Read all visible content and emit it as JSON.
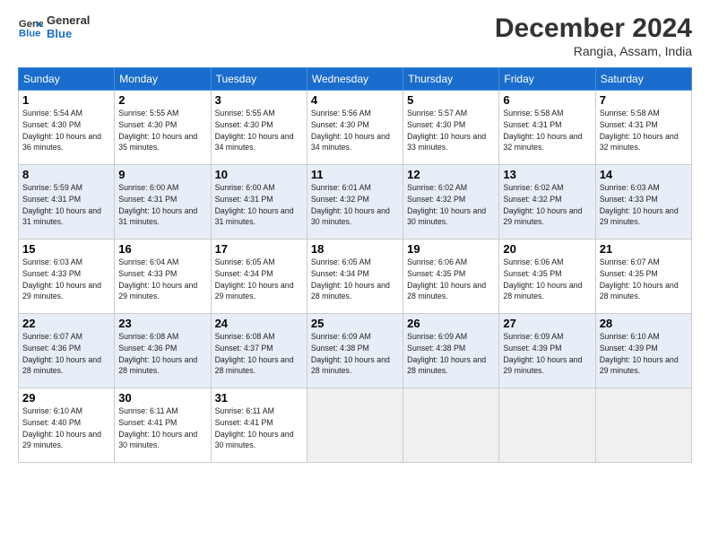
{
  "logo": {
    "line1": "General",
    "line2": "Blue"
  },
  "title": "December 2024",
  "location": "Rangia, Assam, India",
  "weekdays": [
    "Sunday",
    "Monday",
    "Tuesday",
    "Wednesday",
    "Thursday",
    "Friday",
    "Saturday"
  ],
  "weeks": [
    [
      {
        "day": "1",
        "rise": "5:54 AM",
        "set": "4:30 PM",
        "hours": "10 hours and 36 minutes."
      },
      {
        "day": "2",
        "rise": "5:55 AM",
        "set": "4:30 PM",
        "hours": "10 hours and 35 minutes."
      },
      {
        "day": "3",
        "rise": "5:55 AM",
        "set": "4:30 PM",
        "hours": "10 hours and 34 minutes."
      },
      {
        "day": "4",
        "rise": "5:56 AM",
        "set": "4:30 PM",
        "hours": "10 hours and 34 minutes."
      },
      {
        "day": "5",
        "rise": "5:57 AM",
        "set": "4:30 PM",
        "hours": "10 hours and 33 minutes."
      },
      {
        "day": "6",
        "rise": "5:58 AM",
        "set": "4:31 PM",
        "hours": "10 hours and 32 minutes."
      },
      {
        "day": "7",
        "rise": "5:58 AM",
        "set": "4:31 PM",
        "hours": "10 hours and 32 minutes."
      }
    ],
    [
      {
        "day": "8",
        "rise": "5:59 AM",
        "set": "4:31 PM",
        "hours": "10 hours and 31 minutes."
      },
      {
        "day": "9",
        "rise": "6:00 AM",
        "set": "4:31 PM",
        "hours": "10 hours and 31 minutes."
      },
      {
        "day": "10",
        "rise": "6:00 AM",
        "set": "4:31 PM",
        "hours": "10 hours and 31 minutes."
      },
      {
        "day": "11",
        "rise": "6:01 AM",
        "set": "4:32 PM",
        "hours": "10 hours and 30 minutes."
      },
      {
        "day": "12",
        "rise": "6:02 AM",
        "set": "4:32 PM",
        "hours": "10 hours and 30 minutes."
      },
      {
        "day": "13",
        "rise": "6:02 AM",
        "set": "4:32 PM",
        "hours": "10 hours and 29 minutes."
      },
      {
        "day": "14",
        "rise": "6:03 AM",
        "set": "4:33 PM",
        "hours": "10 hours and 29 minutes."
      }
    ],
    [
      {
        "day": "15",
        "rise": "6:03 AM",
        "set": "4:33 PM",
        "hours": "10 hours and 29 minutes."
      },
      {
        "day": "16",
        "rise": "6:04 AM",
        "set": "4:33 PM",
        "hours": "10 hours and 29 minutes."
      },
      {
        "day": "17",
        "rise": "6:05 AM",
        "set": "4:34 PM",
        "hours": "10 hours and 29 minutes."
      },
      {
        "day": "18",
        "rise": "6:05 AM",
        "set": "4:34 PM",
        "hours": "10 hours and 28 minutes."
      },
      {
        "day": "19",
        "rise": "6:06 AM",
        "set": "4:35 PM",
        "hours": "10 hours and 28 minutes."
      },
      {
        "day": "20",
        "rise": "6:06 AM",
        "set": "4:35 PM",
        "hours": "10 hours and 28 minutes."
      },
      {
        "day": "21",
        "rise": "6:07 AM",
        "set": "4:35 PM",
        "hours": "10 hours and 28 minutes."
      }
    ],
    [
      {
        "day": "22",
        "rise": "6:07 AM",
        "set": "4:36 PM",
        "hours": "10 hours and 28 minutes."
      },
      {
        "day": "23",
        "rise": "6:08 AM",
        "set": "4:36 PM",
        "hours": "10 hours and 28 minutes."
      },
      {
        "day": "24",
        "rise": "6:08 AM",
        "set": "4:37 PM",
        "hours": "10 hours and 28 minutes."
      },
      {
        "day": "25",
        "rise": "6:09 AM",
        "set": "4:38 PM",
        "hours": "10 hours and 28 minutes."
      },
      {
        "day": "26",
        "rise": "6:09 AM",
        "set": "4:38 PM",
        "hours": "10 hours and 28 minutes."
      },
      {
        "day": "27",
        "rise": "6:09 AM",
        "set": "4:39 PM",
        "hours": "10 hours and 29 minutes."
      },
      {
        "day": "28",
        "rise": "6:10 AM",
        "set": "4:39 PM",
        "hours": "10 hours and 29 minutes."
      }
    ],
    [
      {
        "day": "29",
        "rise": "6:10 AM",
        "set": "4:40 PM",
        "hours": "10 hours and 29 minutes."
      },
      {
        "day": "30",
        "rise": "6:11 AM",
        "set": "4:41 PM",
        "hours": "10 hours and 30 minutes."
      },
      {
        "day": "31",
        "rise": "6:11 AM",
        "set": "4:41 PM",
        "hours": "10 hours and 30 minutes."
      },
      null,
      null,
      null,
      null
    ]
  ]
}
